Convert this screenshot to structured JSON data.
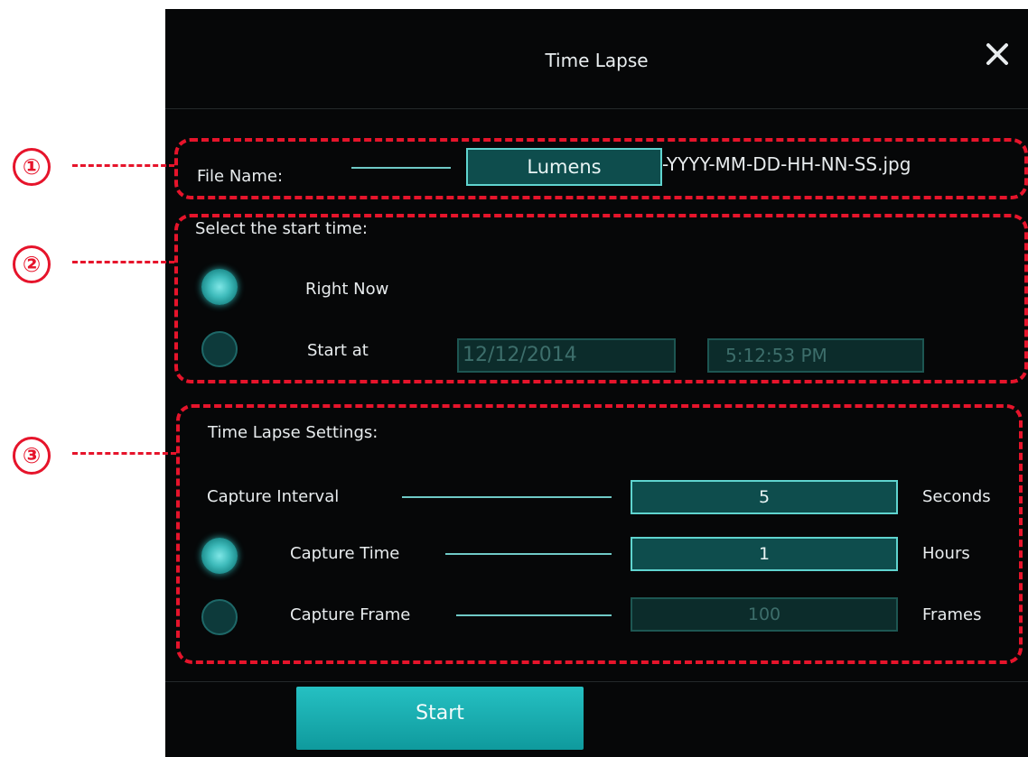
{
  "dialog": {
    "title": "Time Lapse",
    "start_label": "Start"
  },
  "file_name": {
    "label": "File Name:",
    "value": "Lumens",
    "suffix": "-YYYY-MM-DD-HH-NN-SS.jpg"
  },
  "start_time": {
    "heading": "Select the start time:",
    "option_now": "Right Now",
    "option_at": "Start at",
    "date": "12/12/2014",
    "time": "5:12:53 PM",
    "selected": "Right Now"
  },
  "settings": {
    "heading": "Time Lapse Settings:",
    "interval_label": "Capture Interval",
    "interval_value": "5",
    "interval_unit": "Seconds",
    "time_label": "Capture Time",
    "time_value": "1",
    "time_unit": "Hours",
    "frame_label": "Capture Frame",
    "frame_value": "100",
    "frame_unit": "Frames",
    "selected": "Capture Time"
  },
  "annotations": {
    "marker_1": "①",
    "marker_2": "②",
    "marker_3": "③"
  },
  "colors": {
    "accent": "#2bbdbf",
    "annotation": "#e6142b",
    "background": "#060708"
  },
  "icons": {
    "close": "close-icon"
  }
}
